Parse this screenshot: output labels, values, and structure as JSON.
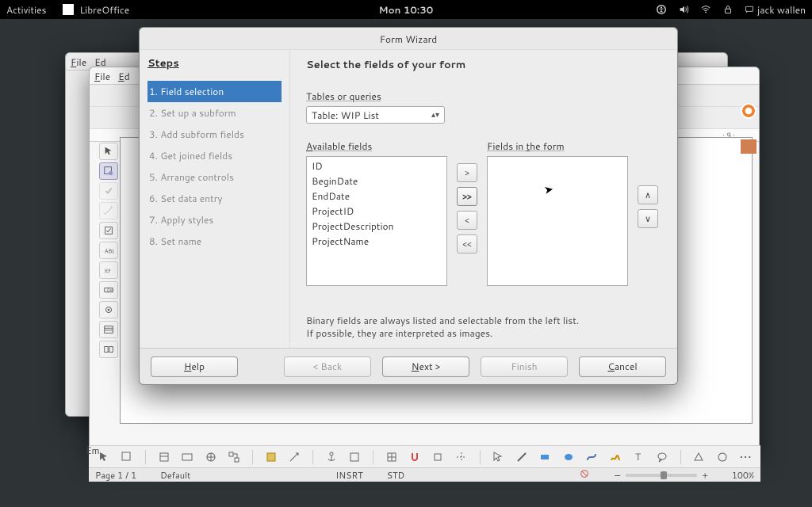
{
  "panel": {
    "activities": "Activities",
    "app": "LibreOffice",
    "clock": "Mon 10:30",
    "user": "jack wallen"
  },
  "bg1_menu": {
    "file": "File",
    "edit": "Ed"
  },
  "bg2_menu": {
    "file": "File",
    "edit": "Ed"
  },
  "ruler_hint": "· 9 ·",
  "dialog": {
    "title": "Form Wizard",
    "steps_head": "Steps",
    "steps": [
      "1. Field selection",
      "2. Set up a subform",
      "3. Add subform fields",
      "4. Get joined fields",
      "5. Arrange controls",
      "6. Set data entry",
      "7. Apply styles",
      "8. Set name"
    ],
    "main_head": "Select the fields of your form",
    "combo_label": "Tables or queries",
    "combo_value": "Table: WIP List",
    "avail_label": "Available fields",
    "form_label": "Fields in the form",
    "available": [
      "ID",
      "BeginDate",
      "EndDate",
      "ProjectID",
      "ProjectDescription",
      "ProjectName"
    ],
    "in_form": [],
    "movers": {
      "add": ">",
      "addall": ">>",
      "remove": "<",
      "removeall": "<<"
    },
    "order": {
      "up": "∧",
      "down": "∨"
    },
    "info1": "Binary fields are always listed and selectable from the left list.",
    "info2": "If possible, they are interpreted as images.",
    "buttons": {
      "help": "Help",
      "back": "< Back",
      "next": "Next >",
      "finish": "Finish",
      "cancel": "Cancel"
    }
  },
  "truncated": "Em",
  "status": {
    "page": "Page 1 / 1",
    "style": "Default",
    "insrt": "INSRT",
    "std": "STD",
    "zoom": "100%"
  }
}
